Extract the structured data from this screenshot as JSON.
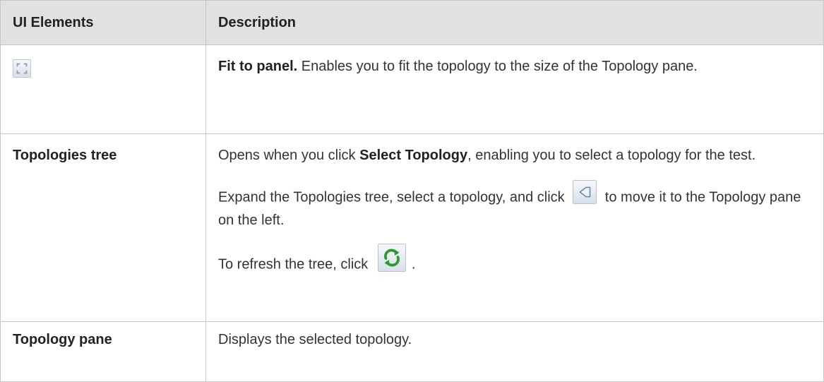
{
  "header": {
    "col_elements": "UI Elements",
    "col_description": "Description"
  },
  "rows": [
    {
      "element_icon": "fit-to-panel-icon",
      "bold": "Fit to panel.",
      "text": " Enables you to fit the topology to the size of the Topology pane."
    },
    {
      "element": "Topologies tree",
      "p1_pre": "Opens when you click ",
      "p1_bold": "Select Topology",
      "p1_post": ", enabling you to select a topology for the test.",
      "p2_pre": "Expand the Topologies tree, select a topology, and click ",
      "p2_icon": "move-left-arrow-icon",
      "p2_post": " to move it to the Topology pane on the left.",
      "p3_pre": "To refresh the tree, click ",
      "p3_icon": "refresh-icon",
      "p3_post": "."
    },
    {
      "element": "Topology pane",
      "text": "Displays the selected topology."
    }
  ],
  "colors": {
    "header_bg": "#e1e1e1",
    "border": "#c6c6c6",
    "text": "#333333",
    "refresh_green": "#2e9a2e"
  }
}
